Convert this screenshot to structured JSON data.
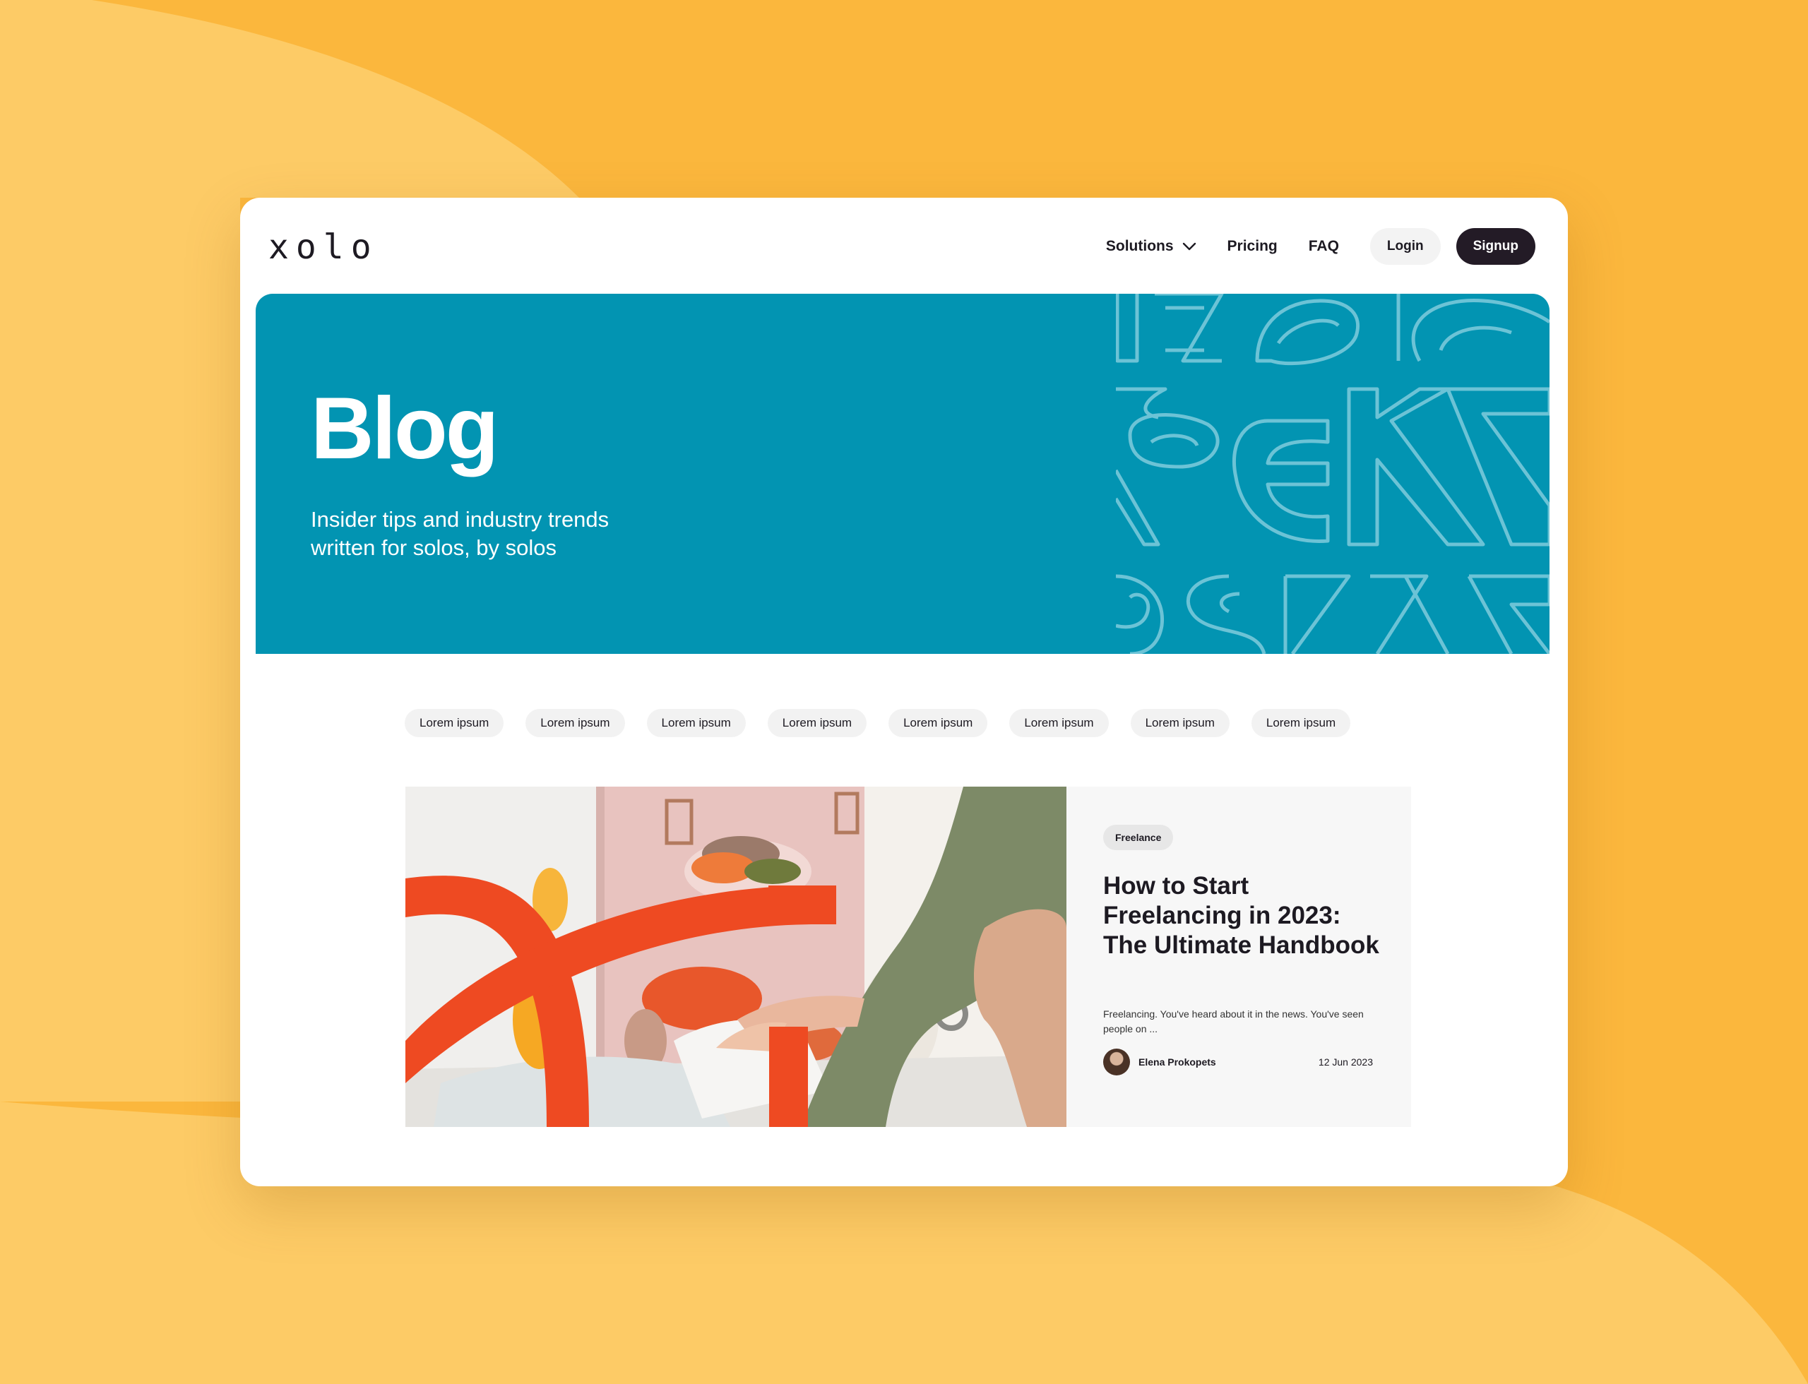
{
  "brand": {
    "logo_text": "xolo"
  },
  "nav": {
    "links": [
      {
        "label": "Solutions"
      },
      {
        "label": "Pricing"
      },
      {
        "label": "FAQ"
      }
    ],
    "login_label": "Login",
    "signup_label": "Signup"
  },
  "hero": {
    "title": "Blog",
    "subtitle": "Insider tips and industry trends written for solos, by solos"
  },
  "categories": [
    "Lorem ipsum",
    "Lorem ipsum",
    "Lorem ipsum",
    "Lorem ipsum",
    "Lorem ipsum",
    "Lorem ipsum",
    "Lorem ipsum",
    "Lorem ipsum"
  ],
  "featured": {
    "tag": "Freelance",
    "title": "How to Start Freelancing in 2023: The Ultimate Handbook",
    "excerpt": "Freelancing. You've heard about it in the news. You've seen people on ...",
    "author": "Elena Prokopets",
    "date": "12 Jun 2023"
  },
  "colors": {
    "background": "#FBB73D",
    "hero": "#0294B2",
    "accent_dark": "#231B26",
    "orange_mark": "#EE4A22"
  },
  "icons": [
    "chevron-down-icon",
    "avatar"
  ]
}
